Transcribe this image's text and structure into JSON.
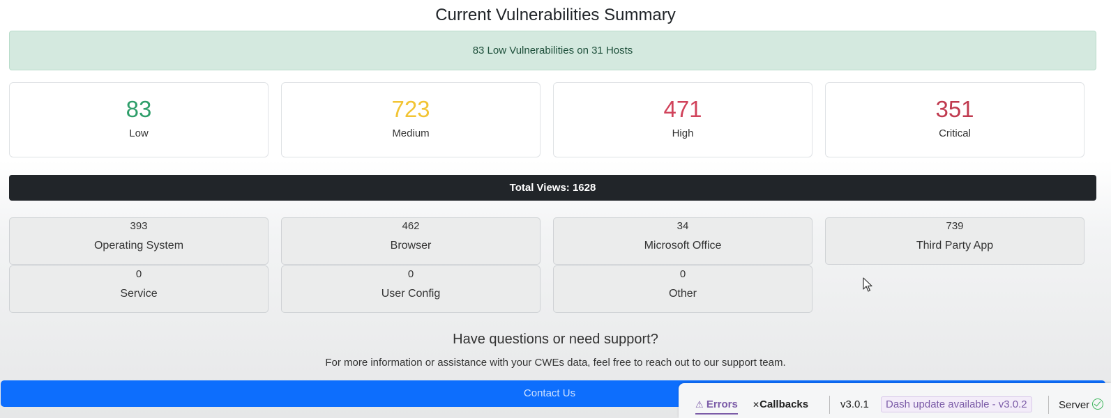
{
  "page": {
    "title": "Current Vulnerabilities Summary"
  },
  "alert": {
    "text": "83 Low Vulnerabilities on 31 Hosts"
  },
  "severity": [
    {
      "count": "83",
      "label": "Low",
      "color": "#2e9e6a"
    },
    {
      "count": "723",
      "label": "Medium",
      "color": "#f2c434"
    },
    {
      "count": "471",
      "label": "High",
      "color": "#d1435b"
    },
    {
      "count": "351",
      "label": "Critical",
      "color": "#c03a4f"
    }
  ],
  "total": {
    "text": "Total Views: 1628"
  },
  "categories": [
    {
      "count": "393",
      "label": "Operating System"
    },
    {
      "count": "462",
      "label": "Browser"
    },
    {
      "count": "34",
      "label": "Microsoft Office"
    },
    {
      "count": "739",
      "label": "Third Party App"
    },
    {
      "count": "0",
      "label": "Service"
    },
    {
      "count": "0",
      "label": "User Config"
    },
    {
      "count": "0",
      "label": "Other"
    }
  ],
  "support": {
    "title": "Have questions or need support?",
    "text": "For more information or assistance with your CWEs data, feel free to reach out to our support team.",
    "button_label": "Contact Us"
  },
  "devtools": {
    "errors_label": "Errors",
    "errors_icon": "⚠",
    "callbacks_label": "Callbacks",
    "callbacks_icon": "✕",
    "version": "v3.0.1",
    "update_text": "Dash update available - v3.0.2",
    "server_label": "Server"
  }
}
